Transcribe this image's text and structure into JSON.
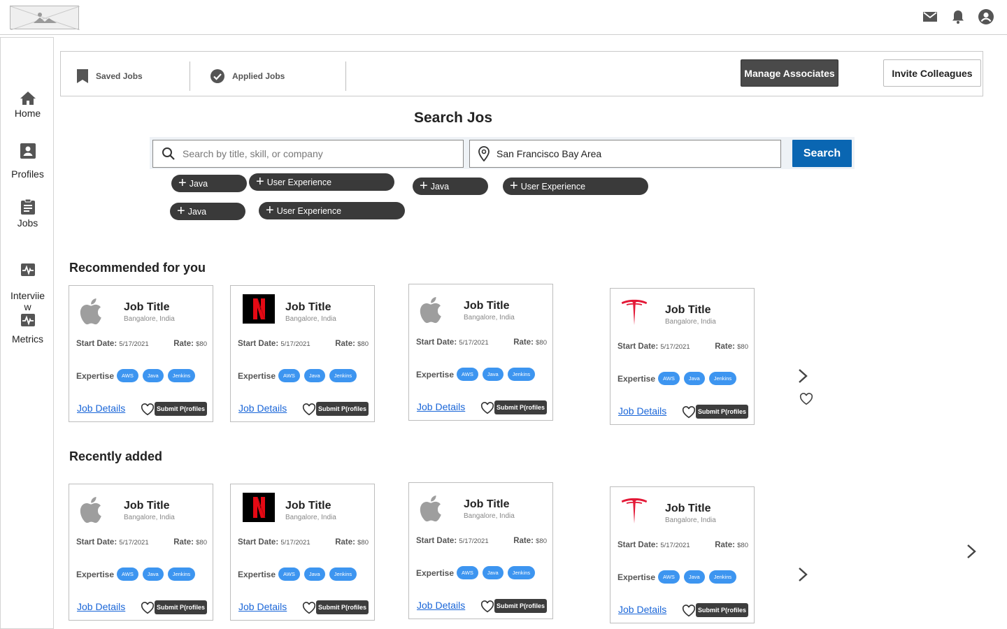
{
  "header": {
    "icons": [
      "mail-icon",
      "bell-icon",
      "account-icon"
    ]
  },
  "sidebar": {
    "items": [
      {
        "label": "Home",
        "icon": "home-icon"
      },
      {
        "label": "Profiles",
        "icon": "profile-icon"
      },
      {
        "label": "Jobs",
        "icon": "clipboard-icon"
      },
      {
        "label": "Interviie\nw",
        "icon": "pulse-icon"
      },
      {
        "label": "Metrics",
        "icon": "pulse-icon"
      }
    ]
  },
  "tabs": {
    "saved": "Saved Jobs",
    "applied": "Applied Jobs",
    "manage": "Manage Associates",
    "invite": "Invite Colleagues"
  },
  "search": {
    "title": "Search Jos",
    "keyword_placeholder": "Search by title, skill, or company",
    "location_value": "San Francisco Bay Area",
    "button": "Search"
  },
  "chips": [
    "Java",
    "User Experience",
    "Java",
    "User Experience",
    "Java",
    "User Experience"
  ],
  "sections": {
    "recommended": "Recommended for you",
    "recent": "Recently added"
  },
  "cards": {
    "job_title": "Job Title",
    "location": "Bangalore, India",
    "start_label": "Start Date:",
    "start_value": "5/17/2021",
    "rate_label": "Rate:",
    "rate_value": "$80",
    "expertise_label": "Expertise",
    "tags": [
      "AWS",
      "Java",
      "Jenkins"
    ],
    "details_link": "Job Details",
    "submit_label": "Submit P(rofiles",
    "companies": [
      "apple",
      "netflix",
      "apple",
      "tesla"
    ]
  },
  "colors": {
    "search_button": "#0a66b2",
    "tag": "#3d95f0",
    "link": "#1a66d8",
    "netflix_red": "#e50914",
    "tesla_red": "#e31937"
  }
}
